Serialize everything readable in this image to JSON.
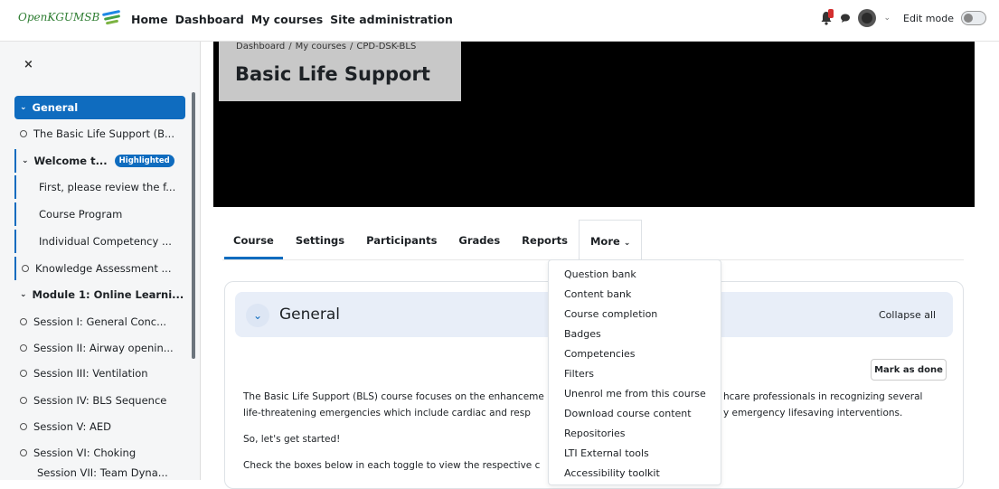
{
  "brand": {
    "name": "OpenKGUMSB"
  },
  "nav": {
    "links": [
      "Home",
      "Dashboard",
      "My courses",
      "Site administration"
    ],
    "edit_mode": "Edit mode"
  },
  "colors": {
    "accent": "#0f6cbf",
    "badge": "#d32f2f"
  },
  "sidebar": {
    "close": "×",
    "items": [
      {
        "label": "General"
      },
      {
        "label": "The Basic Life Support (B..."
      },
      {
        "label": "Welcome t...",
        "badge": "Highlighted"
      },
      {
        "label": "First, please review the f..."
      },
      {
        "label": "Course Program"
      },
      {
        "label": "Individual Competency ..."
      },
      {
        "label": "Knowledge Assessment ..."
      },
      {
        "label": "Module 1: Online Learni..."
      },
      {
        "label": "Session I: General Conc..."
      },
      {
        "label": "Session II: Airway openin..."
      },
      {
        "label": "Session III: Ventilation"
      },
      {
        "label": "Session IV: BLS Sequence"
      },
      {
        "label": "Session V: AED"
      },
      {
        "label": "Session VI: Choking"
      },
      {
        "label": "Session VII: Team Dyna..."
      }
    ]
  },
  "header": {
    "breadcrumb": [
      "Dashboard",
      "/",
      "My courses",
      "/",
      "CPD-DSK-BLS"
    ],
    "title": "Basic Life Support"
  },
  "tabs": [
    "Course",
    "Settings",
    "Participants",
    "Grades",
    "Reports",
    "More"
  ],
  "more_menu": [
    "Question bank",
    "Content bank",
    "Course completion",
    "Badges",
    "Competencies",
    "Filters",
    "Unenrol me from this course",
    "Download course content",
    "Repositories",
    "LTI External tools",
    "Accessibility toolkit"
  ],
  "section": {
    "title": "General",
    "collapse_all": "Collapse all",
    "mark_done": "Mark as done",
    "para1_a": "The Basic Life Support (BLS) course focuses on the enhanceme",
    "para1_b": "hcare professionals in recognizing several",
    "para2_a": "life-threatening emergencies which include cardiac and resp",
    "para2_b": "y emergency lifesaving interventions.",
    "para3": "So, let's get started!",
    "para4": "Check the boxes below in each toggle to view the respective c"
  }
}
